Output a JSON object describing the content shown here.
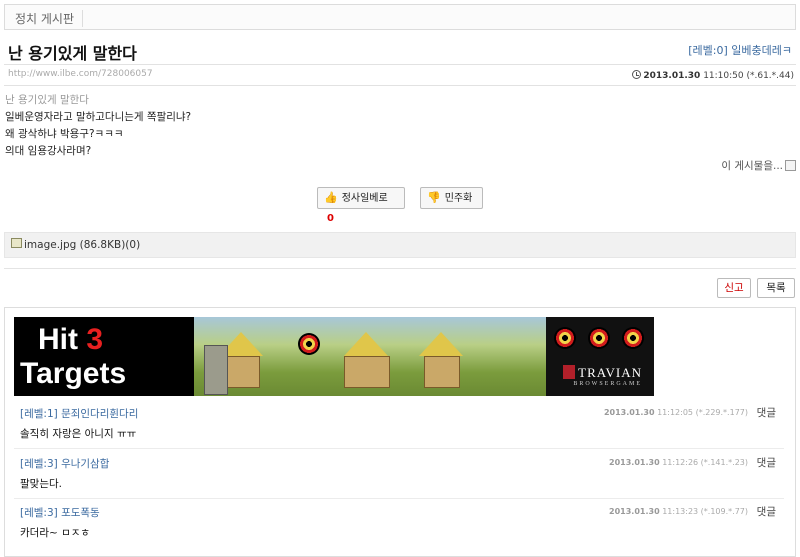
{
  "board": {
    "name": "정치 게시판"
  },
  "post": {
    "title": "난 용기있게 말한다",
    "author": "[레벨:0] 일베충데레ㅋ",
    "url": "http://www.ilbe.com/728006057",
    "date": "2013.01.30",
    "time": "11:10:50",
    "ip": "(*.61.*.44)",
    "lines": [
      "난 용기있게 말한다",
      "일베운영자라고 말하고다니는게 쪽팔리냐?",
      "왜 광삭하냐 박용구?ㅋㅋㅋ",
      "의대 임용강사라며?"
    ],
    "share_label": "이 게시물을...",
    "vote_up_label": "정사일베로",
    "vote_up_count": "0",
    "vote_down_label": "민주화",
    "attachment": "image.jpg (86.8KB)(0)"
  },
  "actions": {
    "report": "신고",
    "list": "목록"
  },
  "ad": {
    "line1_prefix": "Hit ",
    "line1_number": "3",
    "line2": "Targets",
    "brand": "TRAVIAN",
    "brand_sub": "BROWSERGAME"
  },
  "comments": [
    {
      "author": "[레벨:1] 문죄인다리휜다리",
      "date": "2013.01.30",
      "time": "11:12:05",
      "ip": "(*.229.*.177)",
      "reply": "댓글",
      "text": "솔직히 자랑은 아니지 ㅠㅠ"
    },
    {
      "author": "[레벨:3] 우나기삼합",
      "date": "2013.01.30",
      "time": "11:12:26",
      "ip": "(*.141.*.23)",
      "reply": "댓글",
      "text": "팔맞는다."
    },
    {
      "author": "[레벨:3] 포도폭동",
      "date": "2013.01.30",
      "time": "11:13:23",
      "ip": "(*.109.*.77)",
      "reply": "댓글",
      "text": "카더라~ ㅁㅈㅎ"
    }
  ]
}
